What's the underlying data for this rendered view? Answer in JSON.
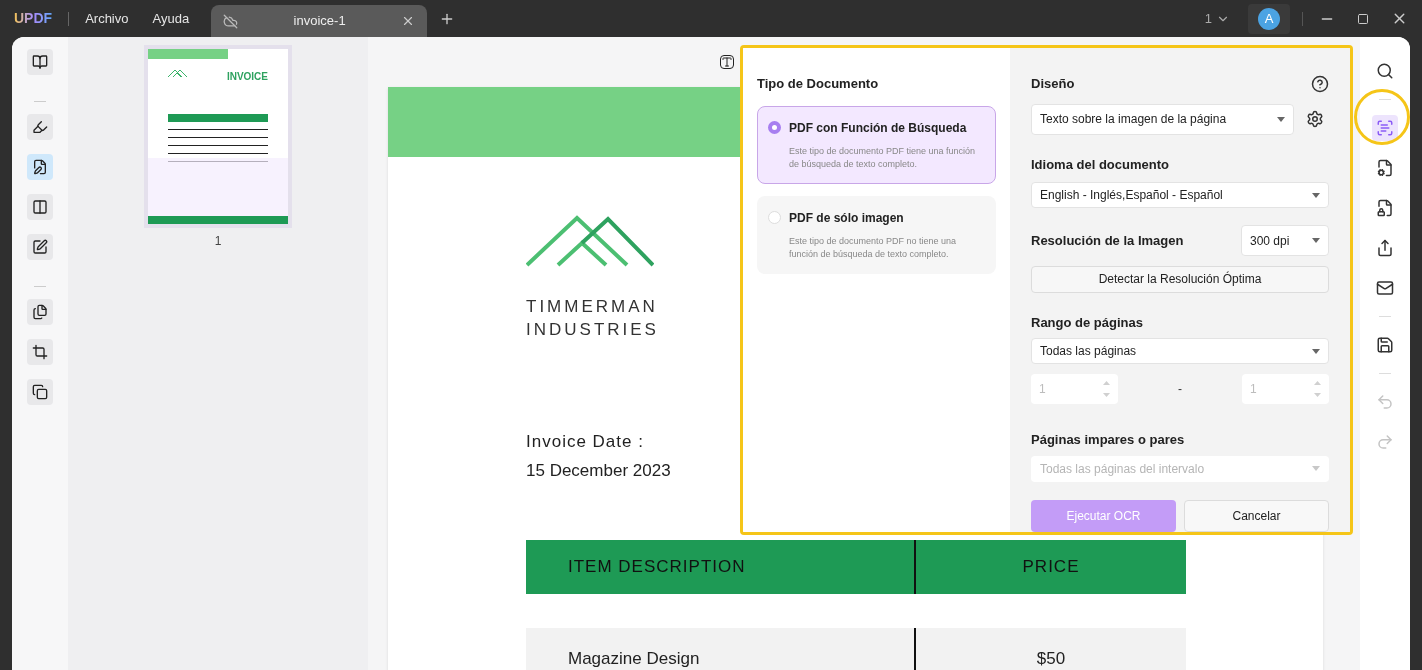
{
  "app": {
    "logo": "UPDF",
    "menu": [
      "Archivo",
      "Ayuda"
    ]
  },
  "tabs": [
    {
      "label": "invoice-1",
      "selected": true
    }
  ],
  "title_bar": {
    "page_count": "1",
    "avatar": "A"
  },
  "left_toolbar": {
    "groups": [
      [
        {
          "selected": false
        }
      ],
      [
        {
          "selected": false
        },
        {
          "selected": true
        },
        {
          "selected": false
        },
        {
          "selected": false
        }
      ],
      [
        {
          "selected": false
        },
        {
          "selected": false
        },
        {
          "selected": false
        }
      ]
    ]
  },
  "thumbnails": [
    {
      "page": "1",
      "title": "INVOICE",
      "selected": true
    }
  ],
  "document": {
    "company": [
      "TIMMERMAN",
      "INDUSTRIES"
    ],
    "invoice_date_label": "Invoice Date :",
    "invoice_date": "15 December 2023",
    "table": {
      "columns": [
        "ITEM DESCRIPTION",
        "PRICE"
      ],
      "rows": [
        [
          "Magazine Design",
          "$50"
        ]
      ]
    }
  },
  "ocr_dialog": {
    "doc_type": {
      "title": "Tipo de Documento",
      "options": [
        {
          "title": "PDF con Función de Búsqueda",
          "description": "Este tipo de documento PDF tiene una función de búsqueda de texto completo.",
          "selected": true
        },
        {
          "title": "PDF de sólo imagen",
          "description": "Este tipo de documento PDF no tiene una función de búsqueda de texto completo.",
          "selected": false
        }
      ]
    },
    "layout": {
      "label": "Diseño",
      "value": "Texto sobre la imagen de la página"
    },
    "language": {
      "label": "Idioma del documento",
      "value": "English - Inglés,Español - Español"
    },
    "resolution": {
      "label": "Resolución de la Imagen",
      "value": "300 dpi",
      "detect_button": "Detectar la Resolución Óptima"
    },
    "page_range": {
      "label": "Rango de páginas",
      "value": "Todas las páginas",
      "from": "1",
      "separator": "-",
      "to": "1",
      "disabled": true
    },
    "odd_even": {
      "label": "Páginas impares o pares",
      "value": "Todas las páginas del intervalo",
      "disabled": true
    },
    "buttons": {
      "run": "Ejecutar OCR",
      "cancel": "Cancelar"
    }
  },
  "right_toolbar": {
    "groups": [
      [
        {
          "selected": false
        }
      ],
      [
        {
          "selected": true
        },
        {
          "selected": false
        },
        {
          "selected": false
        },
        {
          "selected": false
        },
        {
          "selected": false
        }
      ],
      [
        {
          "selected": false
        }
      ],
      [
        {
          "disabled": true
        },
        {
          "disabled": true
        }
      ]
    ]
  }
}
